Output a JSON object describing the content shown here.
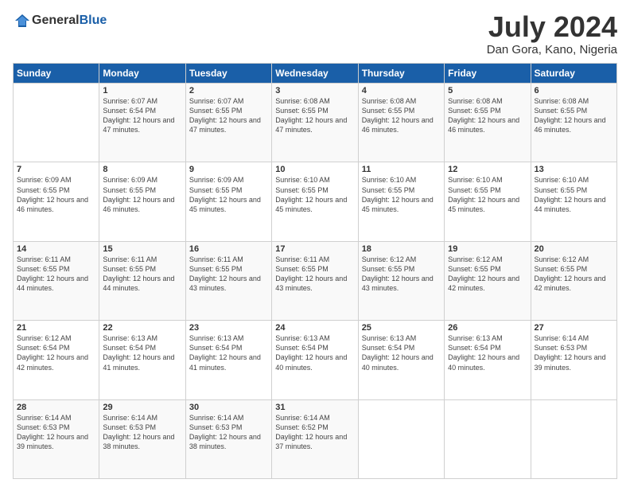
{
  "header": {
    "logo": {
      "general": "General",
      "blue": "Blue"
    },
    "title": "July 2024",
    "location": "Dan Gora, Kano, Nigeria"
  },
  "days_of_week": [
    "Sunday",
    "Monday",
    "Tuesday",
    "Wednesday",
    "Thursday",
    "Friday",
    "Saturday"
  ],
  "weeks": [
    [
      {
        "day": "",
        "sunrise": "",
        "sunset": "",
        "daylight": ""
      },
      {
        "day": "1",
        "sunrise": "Sunrise: 6:07 AM",
        "sunset": "Sunset: 6:54 PM",
        "daylight": "Daylight: 12 hours and 47 minutes."
      },
      {
        "day": "2",
        "sunrise": "Sunrise: 6:07 AM",
        "sunset": "Sunset: 6:55 PM",
        "daylight": "Daylight: 12 hours and 47 minutes."
      },
      {
        "day": "3",
        "sunrise": "Sunrise: 6:08 AM",
        "sunset": "Sunset: 6:55 PM",
        "daylight": "Daylight: 12 hours and 47 minutes."
      },
      {
        "day": "4",
        "sunrise": "Sunrise: 6:08 AM",
        "sunset": "Sunset: 6:55 PM",
        "daylight": "Daylight: 12 hours and 46 minutes."
      },
      {
        "day": "5",
        "sunrise": "Sunrise: 6:08 AM",
        "sunset": "Sunset: 6:55 PM",
        "daylight": "Daylight: 12 hours and 46 minutes."
      },
      {
        "day": "6",
        "sunrise": "Sunrise: 6:08 AM",
        "sunset": "Sunset: 6:55 PM",
        "daylight": "Daylight: 12 hours and 46 minutes."
      }
    ],
    [
      {
        "day": "7",
        "sunrise": "Sunrise: 6:09 AM",
        "sunset": "Sunset: 6:55 PM",
        "daylight": "Daylight: 12 hours and 46 minutes."
      },
      {
        "day": "8",
        "sunrise": "Sunrise: 6:09 AM",
        "sunset": "Sunset: 6:55 PM",
        "daylight": "Daylight: 12 hours and 46 minutes."
      },
      {
        "day": "9",
        "sunrise": "Sunrise: 6:09 AM",
        "sunset": "Sunset: 6:55 PM",
        "daylight": "Daylight: 12 hours and 45 minutes."
      },
      {
        "day": "10",
        "sunrise": "Sunrise: 6:10 AM",
        "sunset": "Sunset: 6:55 PM",
        "daylight": "Daylight: 12 hours and 45 minutes."
      },
      {
        "day": "11",
        "sunrise": "Sunrise: 6:10 AM",
        "sunset": "Sunset: 6:55 PM",
        "daylight": "Daylight: 12 hours and 45 minutes."
      },
      {
        "day": "12",
        "sunrise": "Sunrise: 6:10 AM",
        "sunset": "Sunset: 6:55 PM",
        "daylight": "Daylight: 12 hours and 45 minutes."
      },
      {
        "day": "13",
        "sunrise": "Sunrise: 6:10 AM",
        "sunset": "Sunset: 6:55 PM",
        "daylight": "Daylight: 12 hours and 44 minutes."
      }
    ],
    [
      {
        "day": "14",
        "sunrise": "Sunrise: 6:11 AM",
        "sunset": "Sunset: 6:55 PM",
        "daylight": "Daylight: 12 hours and 44 minutes."
      },
      {
        "day": "15",
        "sunrise": "Sunrise: 6:11 AM",
        "sunset": "Sunset: 6:55 PM",
        "daylight": "Daylight: 12 hours and 44 minutes."
      },
      {
        "day": "16",
        "sunrise": "Sunrise: 6:11 AM",
        "sunset": "Sunset: 6:55 PM",
        "daylight": "Daylight: 12 hours and 43 minutes."
      },
      {
        "day": "17",
        "sunrise": "Sunrise: 6:11 AM",
        "sunset": "Sunset: 6:55 PM",
        "daylight": "Daylight: 12 hours and 43 minutes."
      },
      {
        "day": "18",
        "sunrise": "Sunrise: 6:12 AM",
        "sunset": "Sunset: 6:55 PM",
        "daylight": "Daylight: 12 hours and 43 minutes."
      },
      {
        "day": "19",
        "sunrise": "Sunrise: 6:12 AM",
        "sunset": "Sunset: 6:55 PM",
        "daylight": "Daylight: 12 hours and 42 minutes."
      },
      {
        "day": "20",
        "sunrise": "Sunrise: 6:12 AM",
        "sunset": "Sunset: 6:55 PM",
        "daylight": "Daylight: 12 hours and 42 minutes."
      }
    ],
    [
      {
        "day": "21",
        "sunrise": "Sunrise: 6:12 AM",
        "sunset": "Sunset: 6:54 PM",
        "daylight": "Daylight: 12 hours and 42 minutes."
      },
      {
        "day": "22",
        "sunrise": "Sunrise: 6:13 AM",
        "sunset": "Sunset: 6:54 PM",
        "daylight": "Daylight: 12 hours and 41 minutes."
      },
      {
        "day": "23",
        "sunrise": "Sunrise: 6:13 AM",
        "sunset": "Sunset: 6:54 PM",
        "daylight": "Daylight: 12 hours and 41 minutes."
      },
      {
        "day": "24",
        "sunrise": "Sunrise: 6:13 AM",
        "sunset": "Sunset: 6:54 PM",
        "daylight": "Daylight: 12 hours and 40 minutes."
      },
      {
        "day": "25",
        "sunrise": "Sunrise: 6:13 AM",
        "sunset": "Sunset: 6:54 PM",
        "daylight": "Daylight: 12 hours and 40 minutes."
      },
      {
        "day": "26",
        "sunrise": "Sunrise: 6:13 AM",
        "sunset": "Sunset: 6:54 PM",
        "daylight": "Daylight: 12 hours and 40 minutes."
      },
      {
        "day": "27",
        "sunrise": "Sunrise: 6:14 AM",
        "sunset": "Sunset: 6:53 PM",
        "daylight": "Daylight: 12 hours and 39 minutes."
      }
    ],
    [
      {
        "day": "28",
        "sunrise": "Sunrise: 6:14 AM",
        "sunset": "Sunset: 6:53 PM",
        "daylight": "Daylight: 12 hours and 39 minutes."
      },
      {
        "day": "29",
        "sunrise": "Sunrise: 6:14 AM",
        "sunset": "Sunset: 6:53 PM",
        "daylight": "Daylight: 12 hours and 38 minutes."
      },
      {
        "day": "30",
        "sunrise": "Sunrise: 6:14 AM",
        "sunset": "Sunset: 6:53 PM",
        "daylight": "Daylight: 12 hours and 38 minutes."
      },
      {
        "day": "31",
        "sunrise": "Sunrise: 6:14 AM",
        "sunset": "Sunset: 6:52 PM",
        "daylight": "Daylight: 12 hours and 37 minutes."
      },
      {
        "day": "",
        "sunrise": "",
        "sunset": "",
        "daylight": ""
      },
      {
        "day": "",
        "sunrise": "",
        "sunset": "",
        "daylight": ""
      },
      {
        "day": "",
        "sunrise": "",
        "sunset": "",
        "daylight": ""
      }
    ]
  ]
}
